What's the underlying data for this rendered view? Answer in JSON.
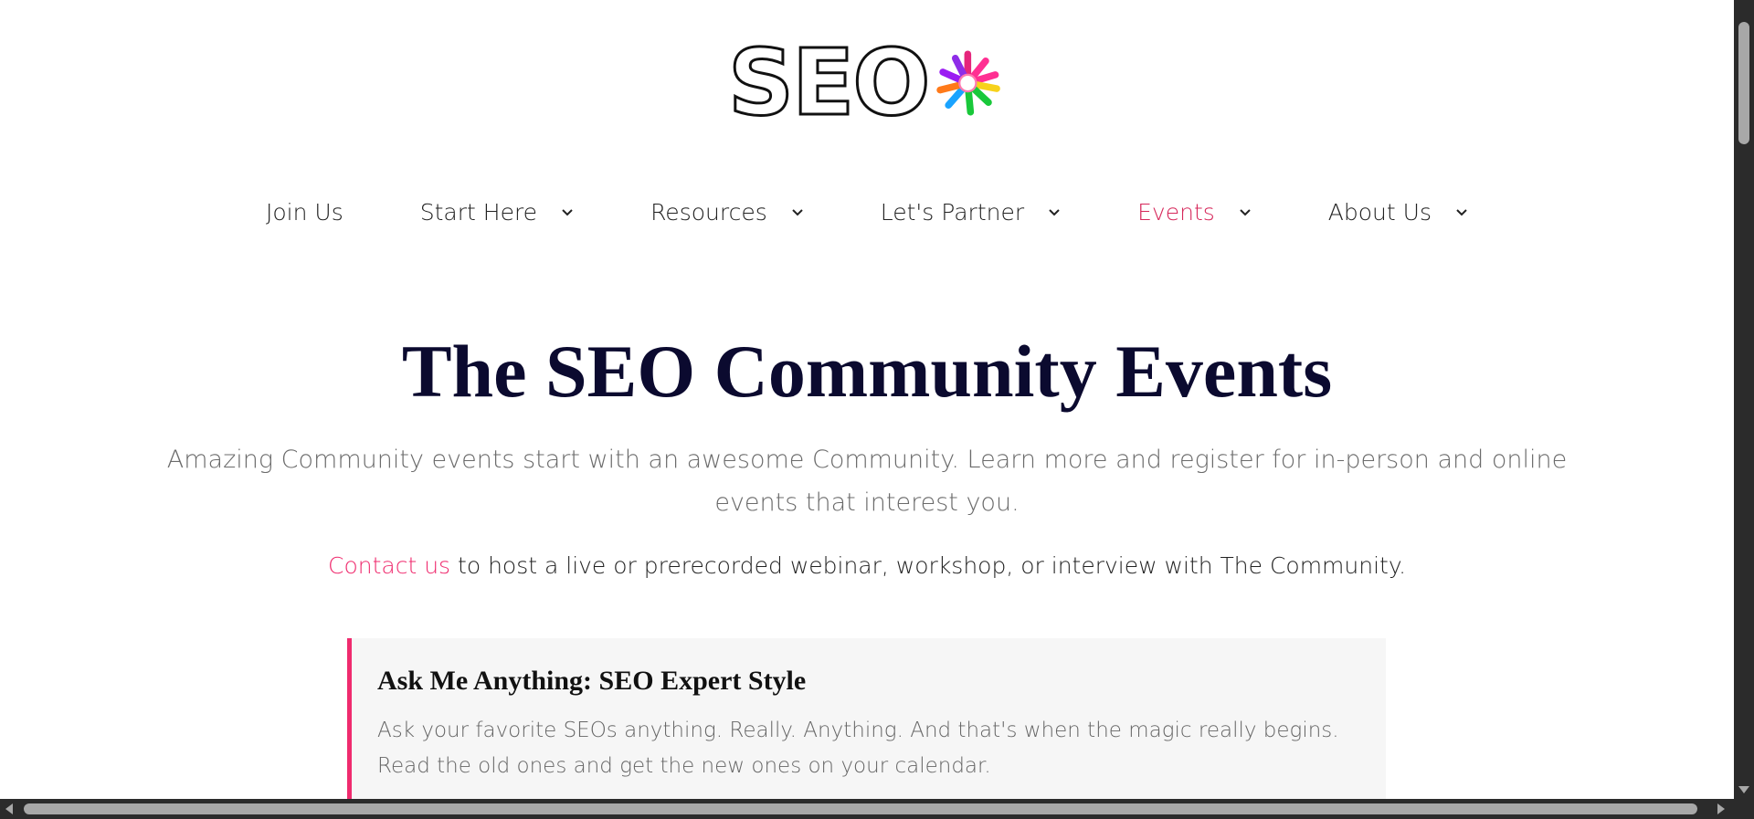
{
  "logo": {
    "text": "SEO",
    "burst_colors": [
      "#ff2f92",
      "#9b1cf2",
      "#1aa3ff",
      "#19c83a",
      "#f7d21b",
      "#ff7a1a",
      "#e5257c",
      "#8e2ce8"
    ]
  },
  "nav": {
    "items": [
      {
        "label": "Join Us",
        "has_dropdown": false,
        "active": false
      },
      {
        "label": "Start Here",
        "has_dropdown": true,
        "active": false
      },
      {
        "label": "Resources",
        "has_dropdown": true,
        "active": false
      },
      {
        "label": "Let's Partner",
        "has_dropdown": true,
        "active": false
      },
      {
        "label": "Events",
        "has_dropdown": true,
        "active": true
      },
      {
        "label": "About Us",
        "has_dropdown": true,
        "active": false
      }
    ]
  },
  "hero": {
    "title": "The SEO Community Events",
    "subtitle": "Amazing Community events start with an awesome Community. Learn more and register for in-person and online events that interest you.",
    "contact_link": "Contact us",
    "contact_rest": " to host a live or prerecorded webinar, workshop, or interview with The Community."
  },
  "card": {
    "title": "Ask Me Anything: SEO Expert Style",
    "description": "Ask your favorite SEOs anything. Really. Anything. And that's when the magic really begins. Read the old ones and get the new ones on your calendar."
  },
  "colors": {
    "accent": "#ef2b6e",
    "active_nav": "#d6275a",
    "title": "#0b0a2f",
    "card_bg": "#f6f6f6"
  }
}
